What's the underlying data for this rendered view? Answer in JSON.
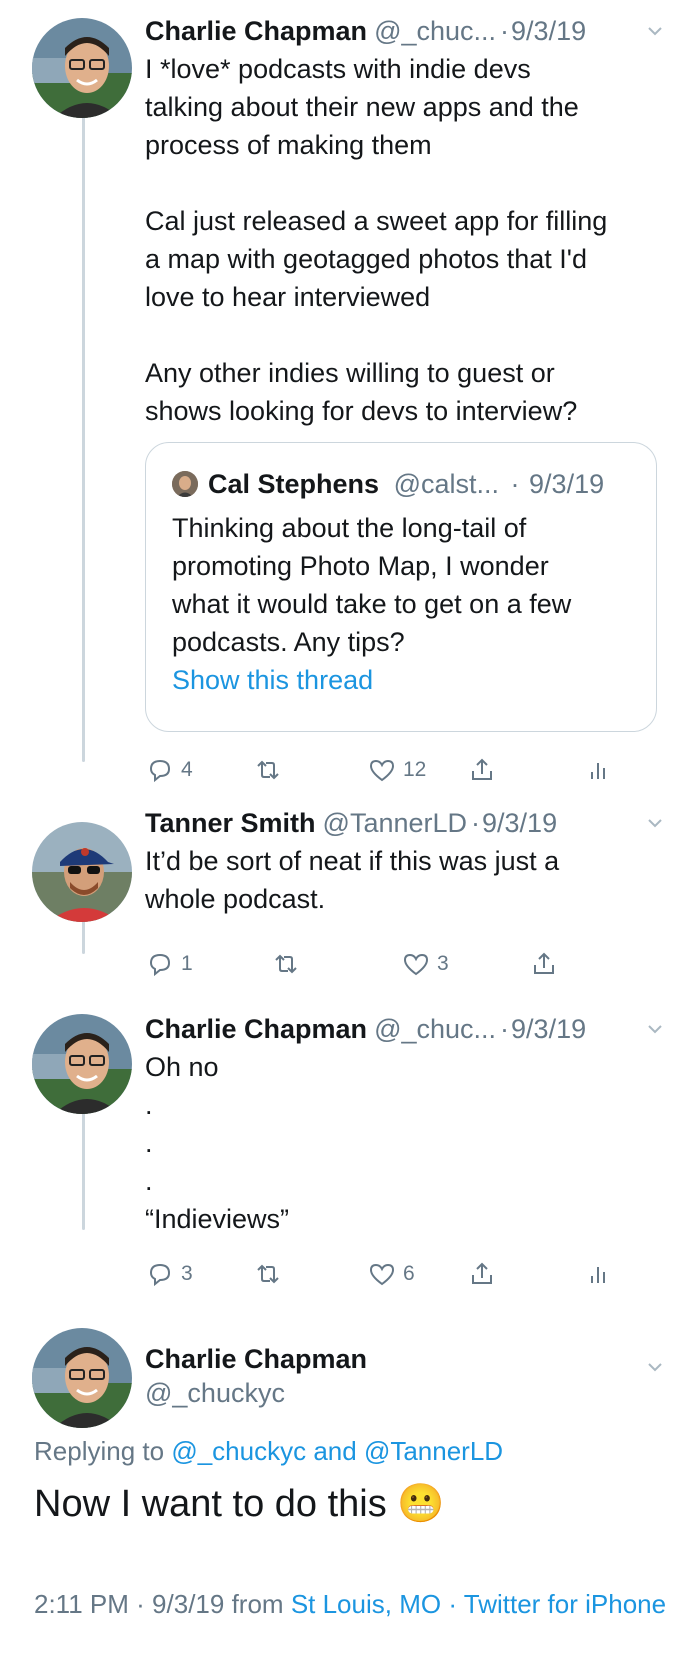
{
  "tweets": [
    {
      "name": "Charlie Chapman",
      "handle": "@_chuc...",
      "dot": "·",
      "date": "9/3/19",
      "body_lines": [
        "I *love* podcasts with indie devs\ntalking about their new apps and the\nprocess of making them",
        "Cal just released a sweet app for filling\na map with geotagged photos that I'd\nlove to hear interviewed",
        "Any other indies willing to guest or\nshows looking for devs to interview?"
      ],
      "quote": {
        "name": "Cal Stephens",
        "handle": "@calst...",
        "dot": "·",
        "date": "9/3/19",
        "text": "Thinking about the long-tail of\npromoting Photo Map, I wonder\nwhat it would take to get on a few\npodcasts. Any tips?",
        "show_thread": "Show this thread"
      },
      "actions": {
        "replies": "4",
        "likes": "12"
      }
    },
    {
      "name": "Tanner Smith",
      "handle": "@TannerLD",
      "dot": "·",
      "date": "9/3/19",
      "body": "It’d be sort of neat if this was just a\nwhole podcast.",
      "actions": {
        "replies": "1",
        "likes": "3"
      }
    },
    {
      "name": "Charlie Chapman",
      "handle": "@_chuc...",
      "dot": "·",
      "date": "9/3/19",
      "body_lines": [
        "Oh no",
        ".",
        ".",
        ".",
        "“Indieviews”"
      ],
      "actions": {
        "replies": "3",
        "likes": "6"
      }
    }
  ],
  "main_tweet": {
    "name": "Charlie Chapman",
    "handle": "@_chuckyc",
    "replying_prefix": "Replying to",
    "replying_user1": "@_chuckyc",
    "replying_and": "and",
    "replying_user2": "@TannerLD",
    "text": "Now I want to do this",
    "emoji": "😬",
    "time": "2:11 PM",
    "sep1": "·",
    "date": "9/3/19",
    "from": "from",
    "location": "St Louis, MO",
    "sep2": "·",
    "client": "Twitter for iPhone"
  },
  "colors": {
    "text": "#14171a",
    "secondary": "#657786",
    "link": "#1b95e0",
    "border": "#ccd6dd"
  },
  "icons": [
    "reply-icon",
    "retweet-icon",
    "like-icon",
    "share-icon",
    "analytics-icon",
    "chevron-down-icon"
  ]
}
